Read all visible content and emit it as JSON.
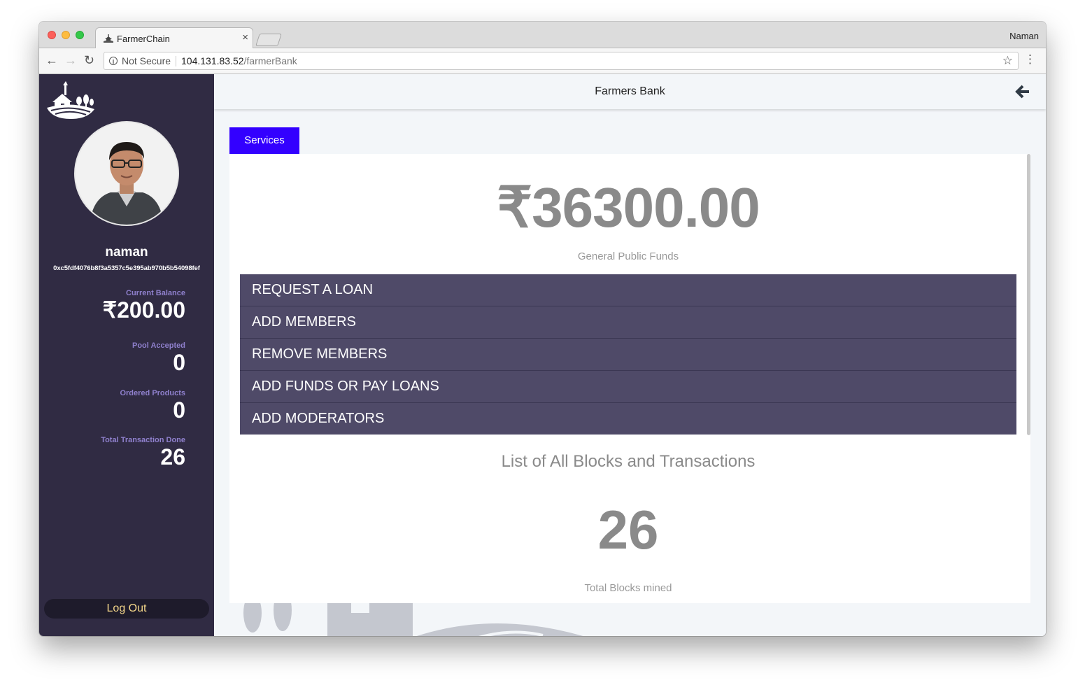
{
  "browser": {
    "tab_title": "FarmerChain",
    "tab_close": "×",
    "profile_name": "Naman",
    "security_label": "Not Secure",
    "url_host": "104.131.83.52",
    "url_path": "/farmerBank",
    "back_glyph": "←",
    "forward_glyph": "→",
    "reload_glyph": "↻",
    "star_glyph": "☆",
    "menu_glyph": "⋮",
    "info_glyph": "i"
  },
  "sidebar": {
    "user_name": "naman",
    "user_address": "0xc5fdf4076b8f3a5357c5e395ab970b5b54098fef",
    "stats": [
      {
        "label": "Current Balance",
        "value": "₹200.00"
      },
      {
        "label": "Pool Accepted",
        "value": "0"
      },
      {
        "label": "Ordered Products",
        "value": "0"
      },
      {
        "label": "Total Transaction Done",
        "value": "26"
      }
    ],
    "logout_label": "Log Out"
  },
  "header": {
    "title": "Farmers Bank"
  },
  "services": {
    "tab_label": "Services",
    "funds_amount": "₹36300.00",
    "funds_label": "General Public Funds",
    "items": [
      "REQUEST A LOAN",
      "ADD MEMBERS",
      "REMOVE MEMBERS",
      "ADD FUNDS OR PAY LOANS",
      "ADD MODERATORS"
    ]
  },
  "blocks": {
    "heading": "List of All Blocks and Transactions",
    "count": "26",
    "label": "Total Blocks mined"
  },
  "colors": {
    "sidebar_bg": "#302b43",
    "accent_blue": "#3300ff",
    "service_item_bg": "#4f4a68",
    "stat_label": "#8f80cd",
    "logout_text": "#f5d78a"
  }
}
